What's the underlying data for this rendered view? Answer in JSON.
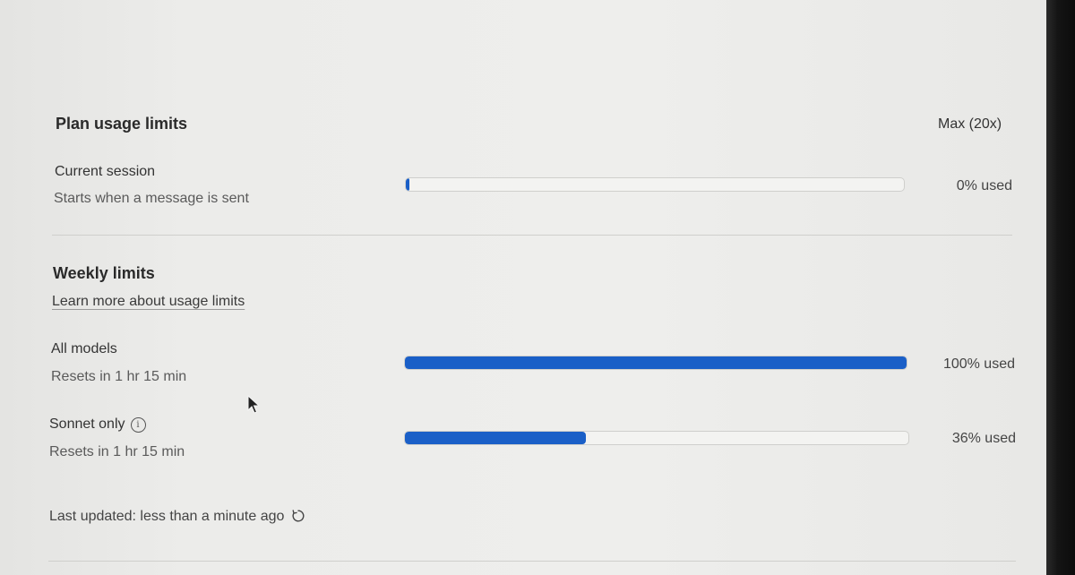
{
  "plan": {
    "title": "Plan usage limits",
    "badge": "Max (20x)"
  },
  "current_session": {
    "label": "Current session",
    "sub": "Starts when a message is sent",
    "usage_text": "0% used",
    "usage_fraction": 0.0
  },
  "weekly": {
    "title": "Weekly limits",
    "learn_more": "Learn more about usage limits",
    "rows": [
      {
        "label": "All models",
        "sub": "Resets in 1 hr 15 min",
        "usage_text": "100% used",
        "usage_fraction": 1.0
      },
      {
        "label": "Sonnet only",
        "sub": "Resets in 1 hr 15 min",
        "usage_text": "36% used",
        "usage_fraction": 0.36
      }
    ]
  },
  "footer": {
    "last_updated": "Last updated: less than a minute ago",
    "refresh_icon": "refresh-icon"
  },
  "colors": {
    "accent": "#1a5fc7",
    "track": "#f3f3f1"
  }
}
